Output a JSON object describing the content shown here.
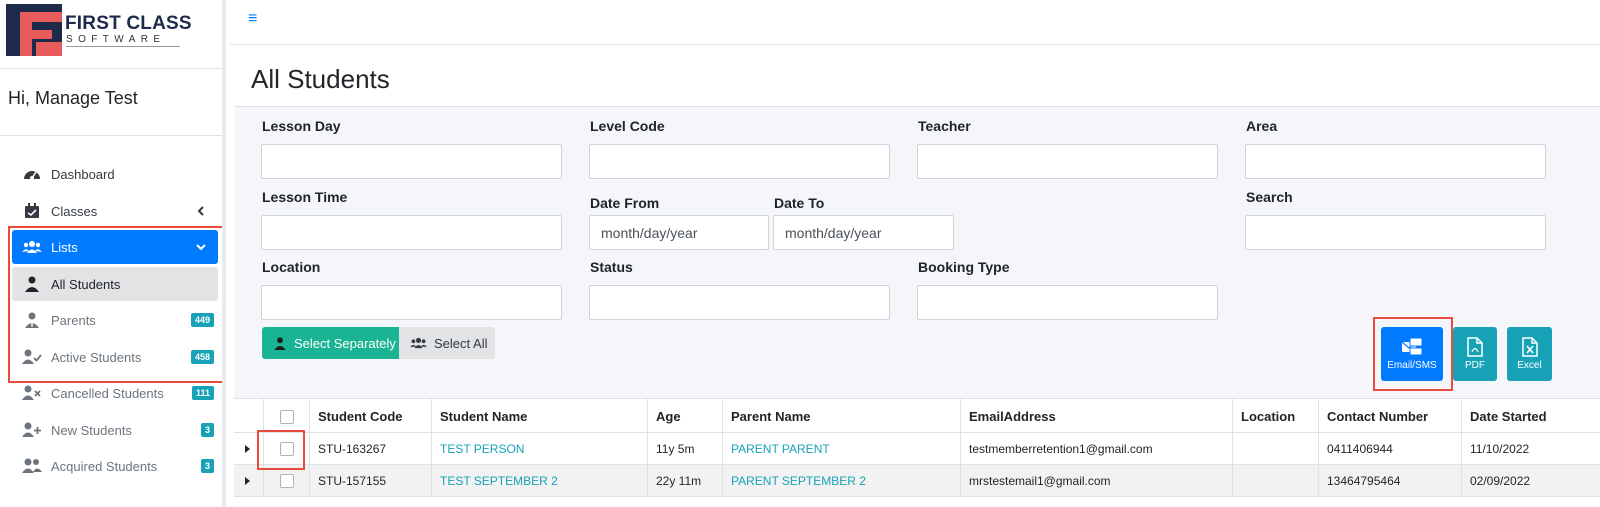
{
  "brand": {
    "name": "FIRST CLASS",
    "sub": "SOFTWARE",
    "primary": "#1e2a4a",
    "accent": "#e85b5b"
  },
  "greeting": "Hi, Manage Test",
  "menu_icon": "≡",
  "sidebar": {
    "items": [
      {
        "label": "Dashboard",
        "icon": "gauge-icon"
      },
      {
        "label": "Classes",
        "icon": "calendar-check-icon",
        "chevron": "‹"
      },
      {
        "label": "Lists",
        "icon": "users-icon",
        "chevron": "⌄",
        "active": true
      },
      {
        "label": "All Students",
        "icon": "user-icon",
        "current": true
      },
      {
        "label": "Parents",
        "icon": "user-tie-icon",
        "badge": "449"
      },
      {
        "label": "Active Students",
        "icon": "user-check-icon",
        "badge": "458"
      },
      {
        "label": "Cancelled Students",
        "icon": "user-times-icon",
        "badge": "111"
      },
      {
        "label": "New Students",
        "icon": "user-plus-icon",
        "badge": "3"
      },
      {
        "label": "Acquired Students",
        "icon": "user-friends-icon",
        "badge": "3"
      }
    ]
  },
  "page_title": "All Students",
  "filters": {
    "lesson_day": "Lesson Day",
    "level_code": "Level Code",
    "teacher": "Teacher",
    "area": "Area",
    "lesson_time": "Lesson Time",
    "date_from": "Date From",
    "date_to": "Date To",
    "date_placeholder": "month/day/year",
    "search": "Search",
    "location": "Location",
    "status": "Status",
    "booking_type": "Booking Type"
  },
  "select": {
    "separately": "Select Separately",
    "all": "Select All"
  },
  "actions": {
    "email": "Email/SMS",
    "pdf": "PDF",
    "excel": "Excel"
  },
  "table": {
    "columns": [
      "Student Code",
      "Student Name",
      "Age",
      "Parent Name",
      "EmailAddress",
      "Location",
      "Contact Number",
      "Date Started"
    ],
    "rows": [
      {
        "code": "STU-163267",
        "name": "TEST PERSON",
        "age": "11y 5m",
        "parent": "PARENT PARENT",
        "email": "testmemberretention1@gmail.com",
        "location": "",
        "contact": "0411406944",
        "date": "11/10/2022"
      },
      {
        "code": "STU-157155",
        "name": "TEST SEPTEMBER 2",
        "age": "22y 11m",
        "parent": "PARENT SEPTEMBER 2",
        "email": "mrstestemail1@gmail.com",
        "location": "",
        "contact": "13464795464",
        "date": "02/09/2022"
      }
    ]
  },
  "colors": {
    "primary": "#007bff",
    "success": "#1ab394",
    "info": "#17a2b8",
    "highlight": "#e74c3c"
  }
}
